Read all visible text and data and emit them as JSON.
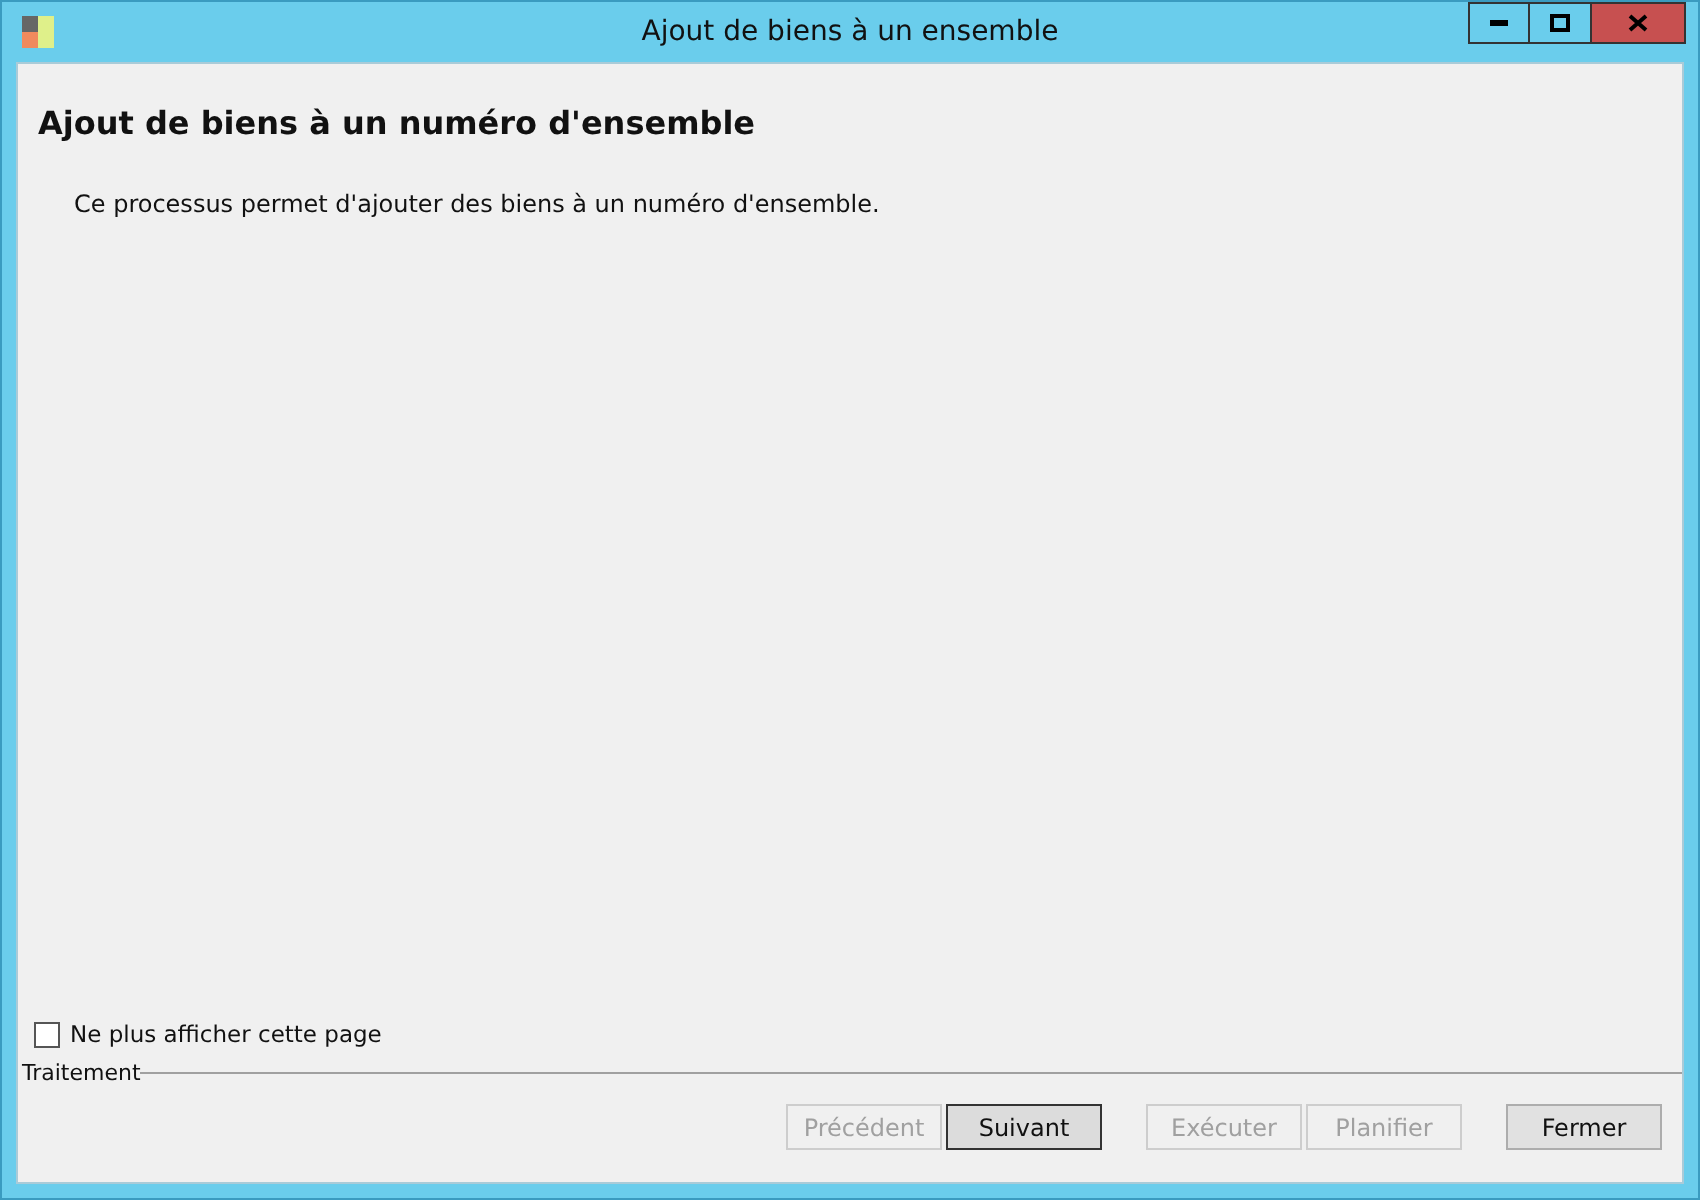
{
  "window": {
    "title": "Ajout de biens à un ensemble"
  },
  "heading": "Ajout de biens à un numéro d'ensemble",
  "description": "Ce processus permet d'ajouter des biens à un numéro d'ensemble.",
  "dont_show_again": {
    "label": "Ne plus afficher cette page",
    "checked": false
  },
  "group_label": "Traitement",
  "buttons": [
    {
      "label": "Précédent",
      "disabled": true,
      "default": false
    },
    {
      "label": "Suivant",
      "disabled": false,
      "default": true
    },
    {
      "label": "Exécuter",
      "disabled": true,
      "default": false
    },
    {
      "label": "Planifier",
      "disabled": true,
      "default": false
    },
    {
      "label": "Fermer",
      "disabled": false,
      "default": false
    }
  ]
}
